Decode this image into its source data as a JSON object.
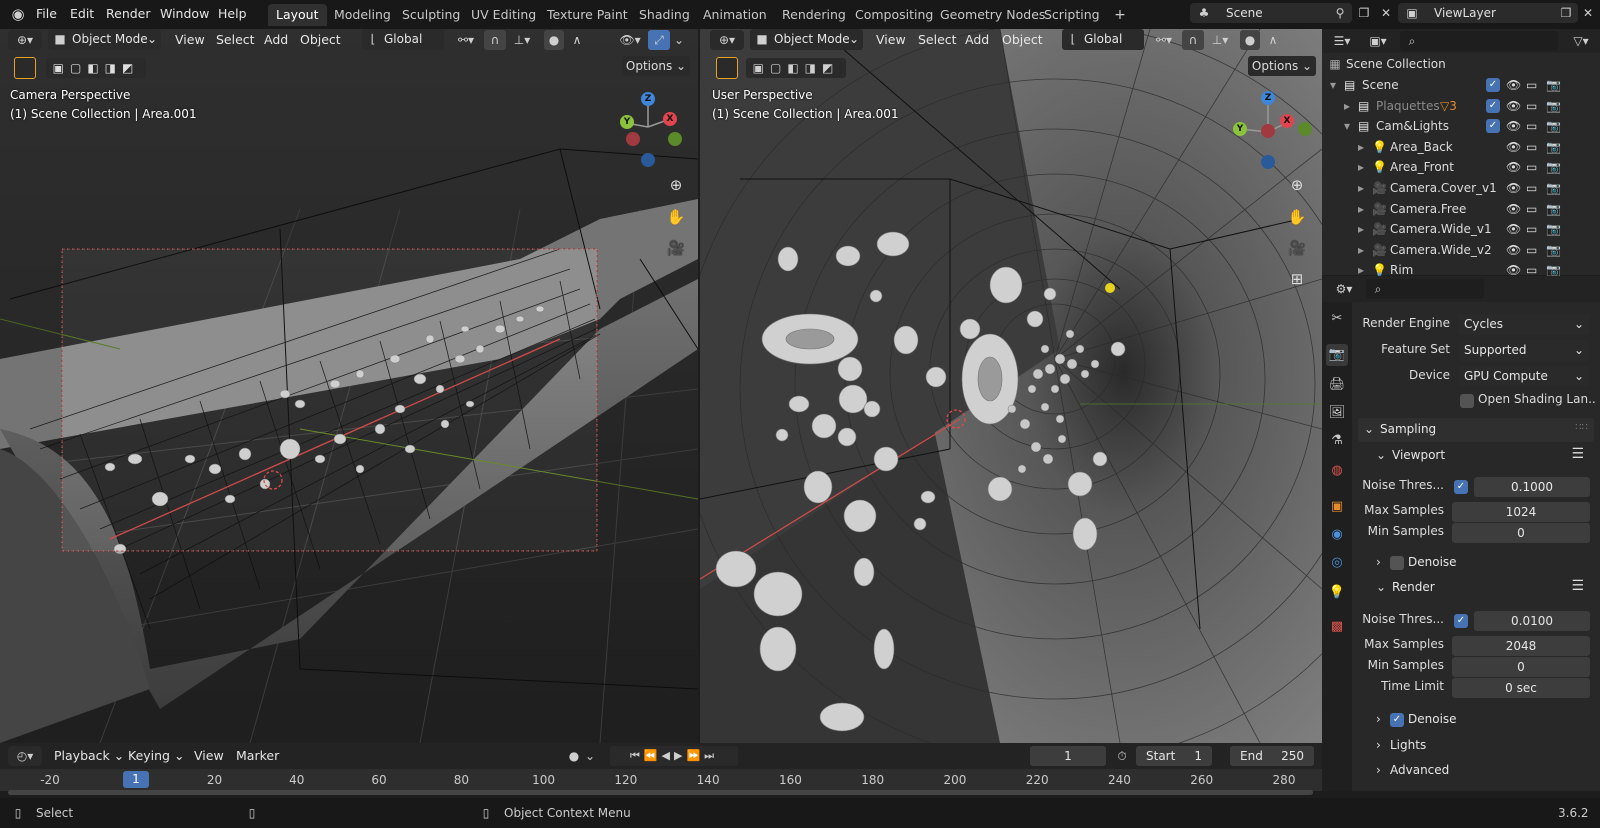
{
  "topbar": {
    "menus": [
      "File",
      "Edit",
      "Render",
      "Window",
      "Help"
    ],
    "workspaces": [
      "Layout",
      "Modeling",
      "Sculpting",
      "UV Editing",
      "Texture Paint",
      "Shading",
      "Animation",
      "Rendering",
      "Compositing",
      "Geometry Nodes",
      "Scripting"
    ],
    "scene": "Scene",
    "view_layer": "ViewLayer"
  },
  "left_vp": {
    "mode": "Object Mode",
    "menus": [
      "View",
      "Select",
      "Add",
      "Object"
    ],
    "orientation": "Global",
    "options": "Options",
    "title": "Camera Perspective",
    "subtitle": "(1) Scene Collection | Area.001"
  },
  "right_vp": {
    "mode": "Object Mode",
    "menus": [
      "View",
      "Select",
      "Add",
      "Object"
    ],
    "orientation": "Global",
    "options": "Options",
    "title": "User Perspective",
    "subtitle": "(1) Scene Collection | Area.001"
  },
  "gizmo": {
    "z": "Z",
    "x": "X",
    "y": "Y",
    "color_x": "#e0454f",
    "color_y": "#8bc43a",
    "color_z": "#3f85d8"
  },
  "outliner": {
    "root": "Scene Collection",
    "items": [
      {
        "name": "Scene",
        "indent": 0,
        "icon": "collection-icon"
      },
      {
        "name": "Plaquettes",
        "indent": 1,
        "icon": "collection-icon",
        "dim": true
      },
      {
        "name": "Cam&Lights",
        "indent": 1,
        "icon": "collection-icon"
      },
      {
        "name": "Area_Back",
        "indent": 2,
        "icon": "light-icon"
      },
      {
        "name": "Area_Front",
        "indent": 2,
        "icon": "light-icon"
      },
      {
        "name": "Camera.Cover_v1",
        "indent": 2,
        "icon": "camera-icon"
      },
      {
        "name": "Camera.Free",
        "indent": 2,
        "icon": "camera-icon"
      },
      {
        "name": "Camera.Wide_v1",
        "indent": 2,
        "icon": "camera-icon"
      },
      {
        "name": "Camera.Wide_v2",
        "indent": 2,
        "icon": "camera-icon"
      },
      {
        "name": "Rim",
        "indent": 2,
        "icon": "light-icon"
      }
    ],
    "badge": "3"
  },
  "props": {
    "render_engine_label": "Render Engine",
    "render_engine": "Cycles",
    "feature_set_label": "Feature Set",
    "feature_set": "Supported",
    "device_label": "Device",
    "device": "GPU Compute",
    "osl": "Open Shading Lan...",
    "sampling": "Sampling",
    "viewport": "Viewport",
    "render": "Render",
    "denoise": "Denoise",
    "lights": "Lights",
    "advanced": "Advanced",
    "noise_label": "Noise Thres...",
    "max_label": "Max Samples",
    "min_label": "Min Samples",
    "time_label": "Time Limit",
    "vp_noise": "0.1000",
    "vp_max": "1024",
    "vp_min": "0",
    "r_noise": "0.0100",
    "r_max": "2048",
    "r_min": "0",
    "r_time": "0 sec"
  },
  "timeline": {
    "menus": [
      "Playback",
      "Keying",
      "View",
      "Marker"
    ],
    "current_frame": "1",
    "start_label": "Start",
    "start": "1",
    "end_label": "End",
    "end": "250",
    "ticks": [
      "-20",
      "20",
      "40",
      "60",
      "80",
      "100",
      "120",
      "140",
      "160",
      "180",
      "200",
      "220",
      "240",
      "260",
      "280"
    ],
    "marker": "1"
  },
  "status": {
    "select": "Select",
    "context": "Object Context Menu",
    "version": "3.6.2"
  }
}
